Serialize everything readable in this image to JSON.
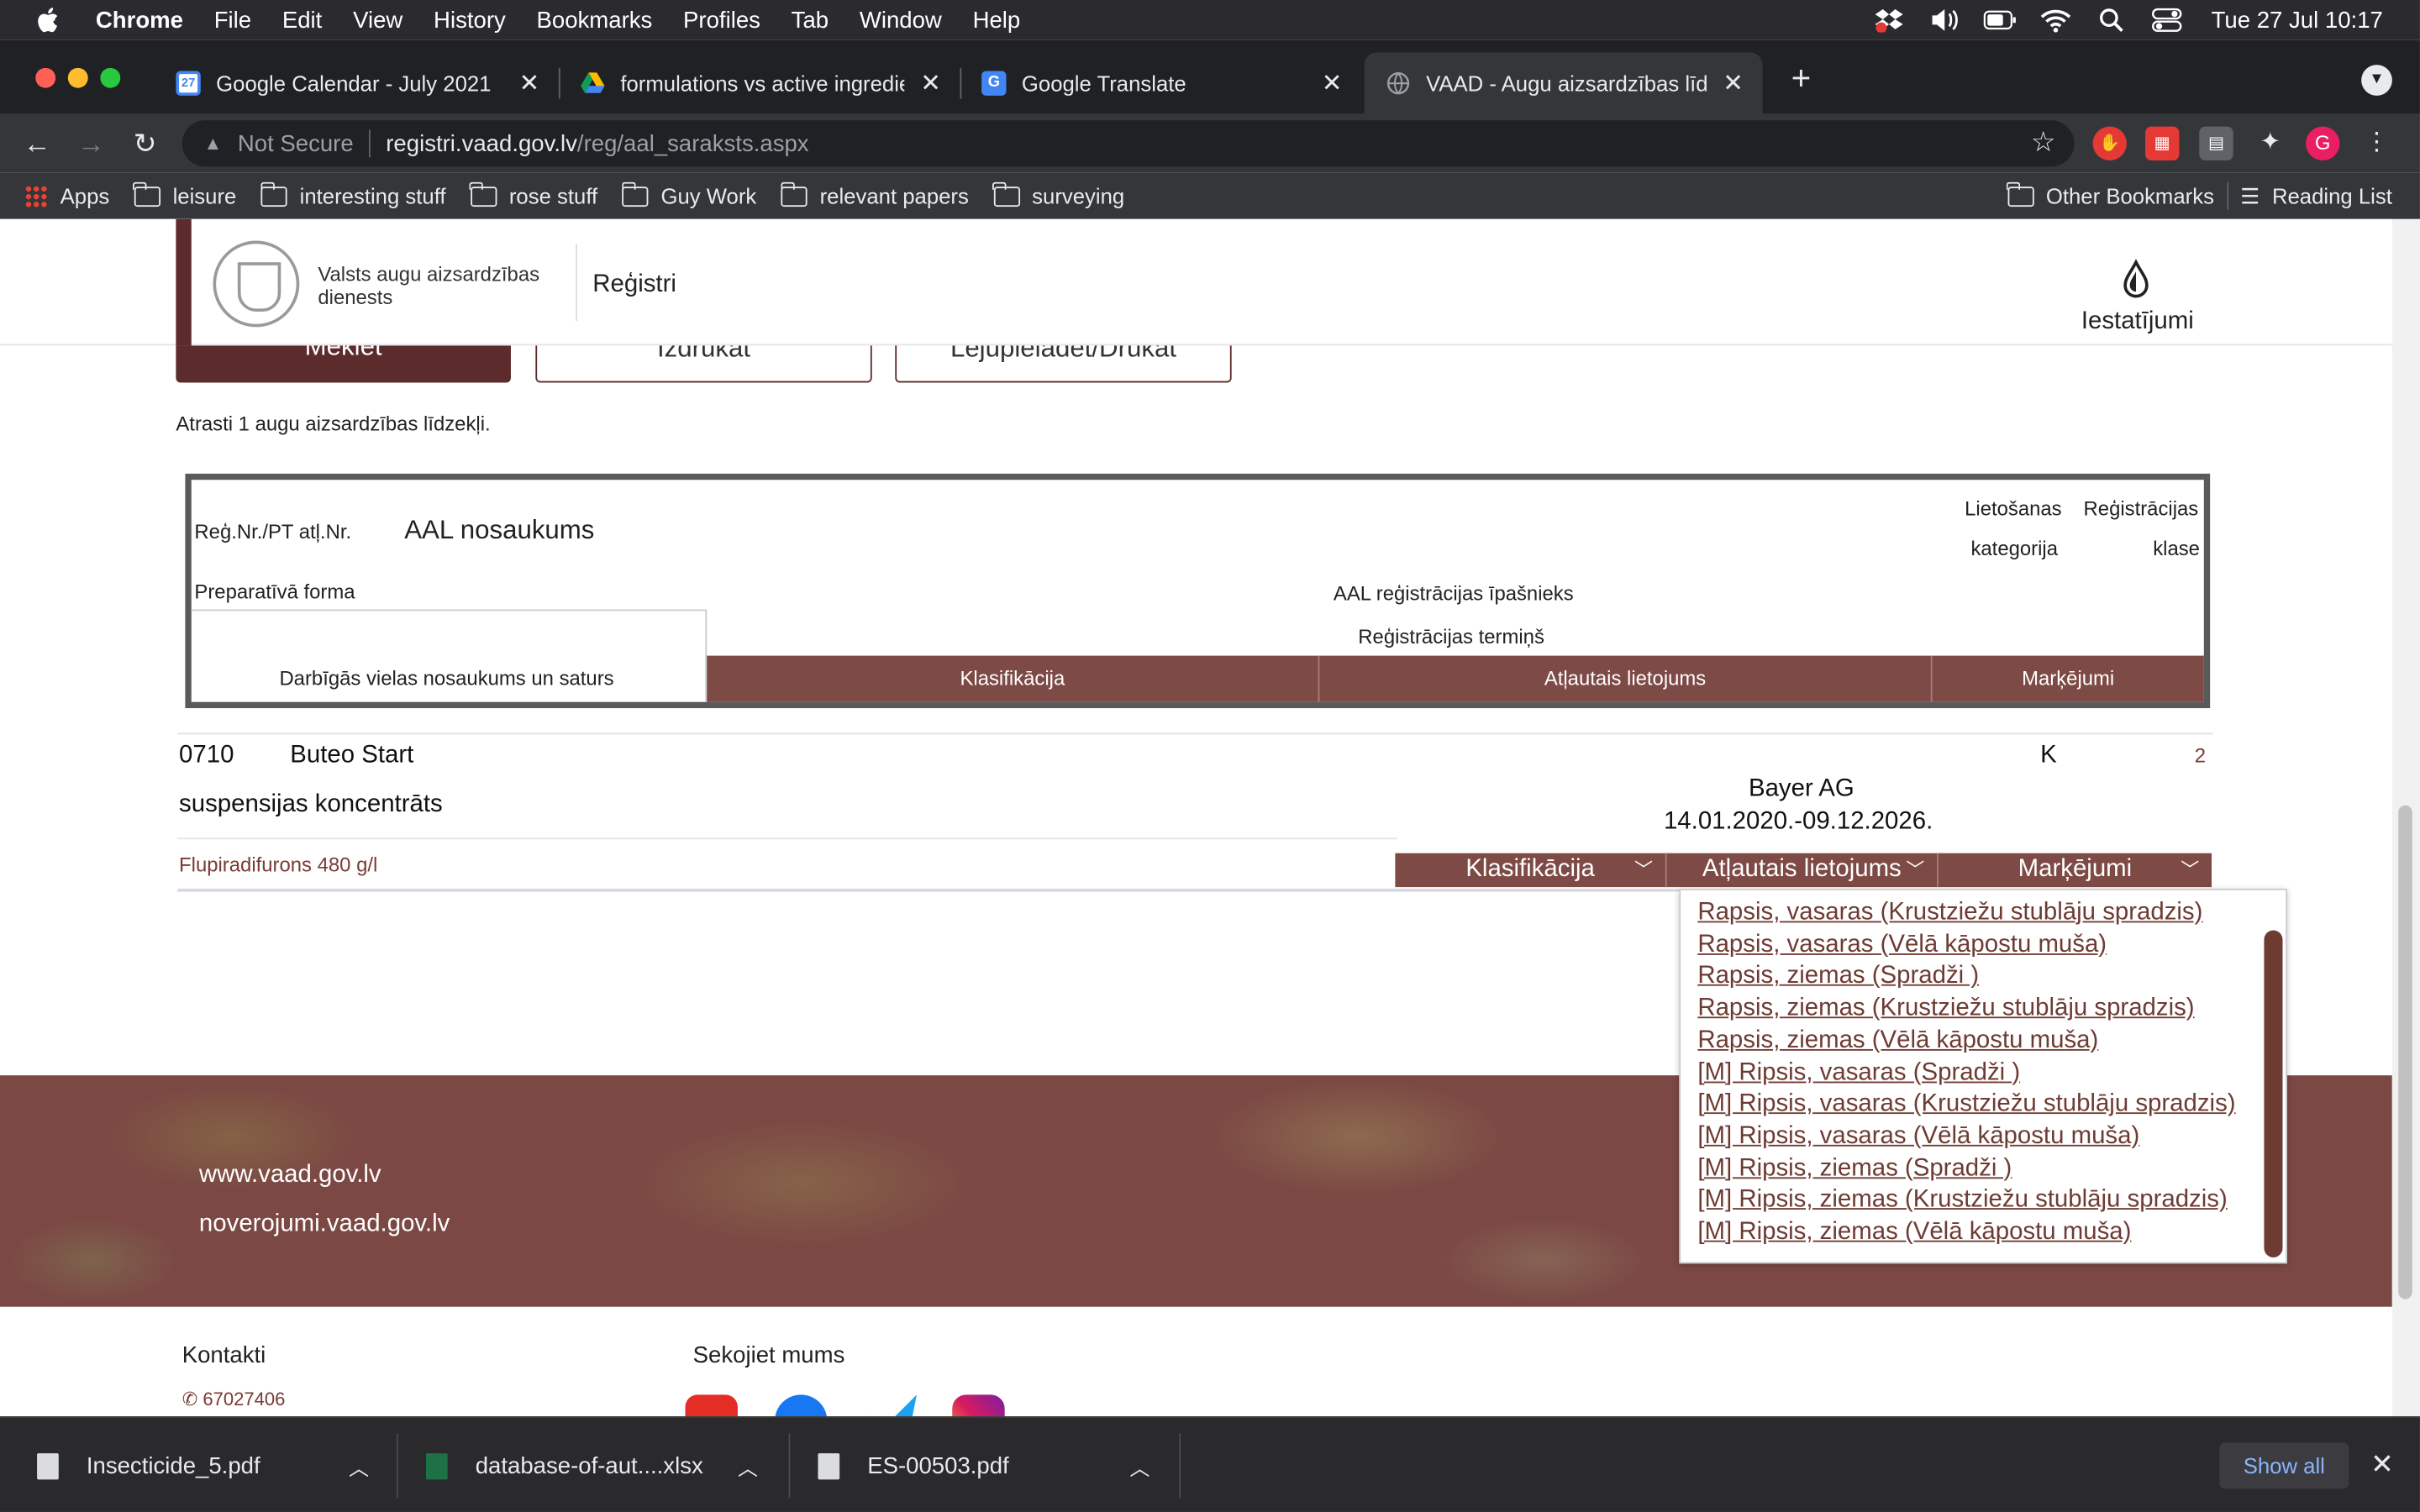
{
  "menubar": {
    "app": "Chrome",
    "items": [
      "File",
      "Edit",
      "View",
      "History",
      "Bookmarks",
      "Profiles",
      "Tab",
      "Window",
      "Help"
    ],
    "clock": "Tue 27 Jul  10:17"
  },
  "tabs": [
    {
      "title": "Google Calendar - July 2021",
      "favicon": "calendar-icon",
      "favicon_text": "27"
    },
    {
      "title": "formulations vs active ingredients",
      "favicon": "google-drive-icon"
    },
    {
      "title": "Google Translate",
      "favicon": "translate-icon"
    },
    {
      "title": "VAAD - Augu aizsardzības līdzekļi",
      "favicon": "globe-icon",
      "active": true
    }
  ],
  "omnibox": {
    "security": "Not Secure",
    "host": "registri.vaad.gov.lv",
    "path": "/reg/aal_saraksts.aspx"
  },
  "extensions": {
    "profile_initial": "G"
  },
  "bookmarks": {
    "items": [
      "Apps",
      "leisure",
      "interesting stuff",
      "rose stuff",
      "Guy Work",
      "relevant papers",
      "surveying"
    ],
    "other": "Other Bookmarks",
    "reading_list": "Reading List"
  },
  "site": {
    "org_name": "Valsts augu aizsardzības dienests",
    "section": "Reģistri",
    "settings": "Iestatījumi",
    "buttons": {
      "search": "Meklēt",
      "clear": "Izdrukāt",
      "download": "Lejupielādēt/Drukāt"
    },
    "results_count": "Atrasti 1 augu aizsardzības līdzekļi."
  },
  "legend": {
    "reg_nr": "Reģ.Nr./PT atļ.Nr.",
    "name": "AAL nosaukums",
    "usage_category_1": "Lietošanas",
    "usage_category_2": "kategorija",
    "reg_class_1": "Reģistrācijas",
    "reg_class_2": "klase",
    "formulation": "Preparatīvā forma",
    "owner": "AAL reģistrācijas īpašnieks",
    "term": "Reģistrācijas termiņš",
    "active_substance": "Darbīgās vielas nosaukums un saturs",
    "bar": [
      "Klasifikācija",
      "Atļautais lietojums",
      "Marķējumi"
    ]
  },
  "result": {
    "reg_nr": "0710",
    "name": "Buteo Start",
    "category": "K",
    "reg_class": "2",
    "formulation": "suspensijas koncentrāts",
    "owner": "Bayer AG",
    "term": "14.01.2020.-09.12.2026.",
    "ingredient": "Flupiradifurons 480 g/l",
    "dropdowns": [
      "Klasifikācija",
      "Atļautais lietojums",
      "Marķējumi"
    ]
  },
  "allowed_uses": [
    "Rapsis, vasaras (Krustziežu stublāju spradzis)",
    "Rapsis, vasaras (Vēlā kāpostu muša)",
    "Rapsis, ziemas (Spradži )",
    "Rapsis, ziemas (Krustziežu stublāju spradzis)",
    "Rapsis, ziemas (Vēlā kāpostu muša)",
    "[M] Ripsis, vasaras (Spradži )",
    "[M] Ripsis, vasaras (Krustziežu stublāju spradzis)",
    "[M] Ripsis, vasaras (Vēlā kāpostu muša)",
    "[M] Ripsis, ziemas (Spradži )",
    "[M] Ripsis, ziemas (Krustziežu stublāju spradzis)",
    "[M] Ripsis, ziemas (Vēlā kāpostu muša)"
  ],
  "footer": {
    "links": [
      "www.vaad.gov.lv",
      "noverojumi.vaad.gov.lv"
    ],
    "contacts": "Kontakti",
    "phone": "67027406",
    "follow": "Sekojiet mums"
  },
  "downloads": {
    "files": [
      "Insecticide_5.pdf",
      "database-of-aut....xlsx",
      "ES-00503.pdf"
    ],
    "show_all": "Show all"
  },
  "colors": {
    "brand": "#5c2b2b",
    "bar": "#7d4a45",
    "link": "#6e3b33"
  }
}
